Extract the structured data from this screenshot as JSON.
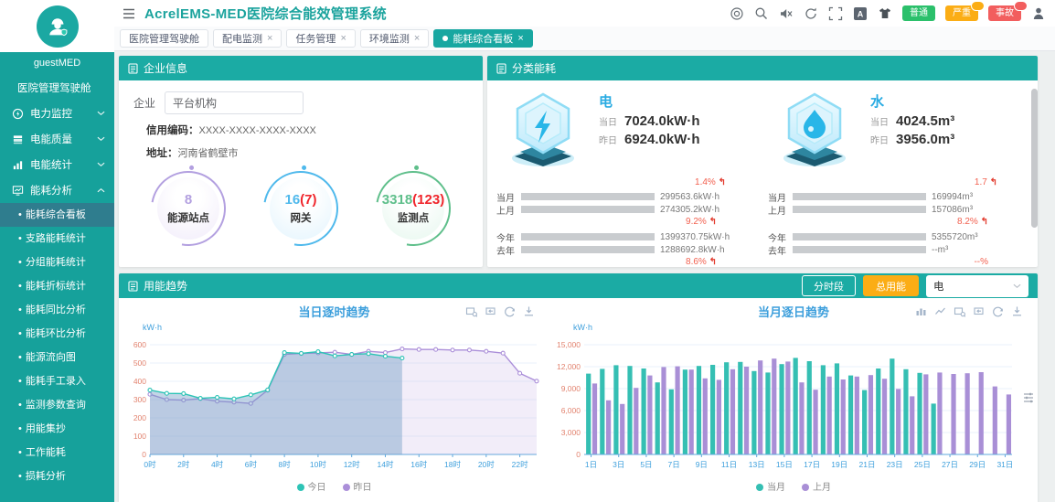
{
  "header": {
    "title": "AcrelEMS-MED医院综合能效管理系统",
    "alarm_badges": [
      {
        "label": "普通",
        "color": "#2BC06B",
        "bubble": false
      },
      {
        "label": "严重",
        "color": "#FBAD15",
        "bubble": true
      },
      {
        "label": "事故",
        "color": "#F25E5E",
        "bubble": true
      }
    ]
  },
  "tabs": [
    {
      "label": "医院管理驾驶舱",
      "closable": false,
      "active": false
    },
    {
      "label": "配电监测",
      "closable": true,
      "active": false
    },
    {
      "label": "任务管理",
      "closable": true,
      "active": false
    },
    {
      "label": "环境监测",
      "closable": true,
      "active": false
    },
    {
      "label": "能耗综合看板",
      "closable": true,
      "active": true
    }
  ],
  "sidebar": {
    "username": "guestMED",
    "dashboard": "医院管理驾驶舱",
    "groups": [
      {
        "label": "电力监控",
        "icon": "power",
        "expanded": false
      },
      {
        "label": "电能质量",
        "icon": "quality",
        "expanded": false
      },
      {
        "label": "电能统计",
        "icon": "stats",
        "expanded": false
      },
      {
        "label": "能耗分析",
        "icon": "analysis",
        "expanded": true
      }
    ],
    "submenu": [
      {
        "label": "能耗综合看板",
        "active": true
      },
      {
        "label": "支路能耗统计",
        "active": false
      },
      {
        "label": "分组能耗统计",
        "active": false
      },
      {
        "label": "能耗折标统计",
        "active": false
      },
      {
        "label": "能耗同比分析",
        "active": false
      },
      {
        "label": "能耗环比分析",
        "active": false
      },
      {
        "label": "能源流向图",
        "active": false
      },
      {
        "label": "能耗手工录入",
        "active": false
      },
      {
        "label": "监测参数查询",
        "active": false
      },
      {
        "label": "用能集抄",
        "active": false
      },
      {
        "label": "工作能耗",
        "active": false
      },
      {
        "label": "损耗分析",
        "active": false
      }
    ]
  },
  "enterprise": {
    "title": "企业信息",
    "company_label": "企业",
    "company_value": "平台机构",
    "credit_label": "信用编码：",
    "credit_value": "XXXX-XXXX-XXXX-XXXX",
    "address_label": "地址：",
    "address_value": "河南省鹤壁市",
    "stats": [
      {
        "value": "8",
        "extra": "",
        "label": "能源站点",
        "color": "#B3A0E0",
        "bg": "#F1ECFA"
      },
      {
        "value": "16",
        "extra": "(7)",
        "label": "网关",
        "color": "#4FB9EC",
        "bg": "#E3F4FD"
      },
      {
        "value": "3318",
        "extra": "(123)",
        "label": "监测点",
        "color": "#5FBF8B",
        "bg": "#E6F7EE"
      }
    ]
  },
  "energy": {
    "title": "分类能耗",
    "sections": [
      {
        "name": "电",
        "icon": "bolt",
        "bar_color": "#4CB8F0",
        "today_label": "当日",
        "today_value": "7024.0kW·h",
        "yest_label": "昨日",
        "yest_value": "6924.0kW·h",
        "day_change": "1.4%",
        "day_arrow": true,
        "bars1": [
          {
            "label": "当月",
            "value": "299563.6kW·h",
            "pct": 52
          },
          {
            "label": "上月",
            "value": "274305.2kW·h",
            "pct": 48
          }
        ],
        "change1": "9.2%",
        "arrow1": true,
        "bars2": [
          {
            "label": "今年",
            "value": "1399370.75kW·h",
            "pct": 53
          },
          {
            "label": "去年",
            "value": "1288692.8kW·h",
            "pct": 48
          }
        ],
        "change2": "8.6%",
        "arrow2": true
      },
      {
        "name": "水",
        "icon": "drop",
        "bar_color": "#4FBE87",
        "today_label": "当日",
        "today_value": "4024.5m³",
        "yest_label": "昨日",
        "yest_value": "3956.0m³",
        "day_change": "1.7",
        "day_arrow": true,
        "bars1": [
          {
            "label": "当月",
            "value": "169994m³",
            "pct": 47
          },
          {
            "label": "上月",
            "value": "157086m³",
            "pct": 43
          }
        ],
        "change1": "8.2%",
        "arrow1": true,
        "bars2": [
          {
            "label": "今年",
            "value": "5355720m³",
            "pct": 100
          },
          {
            "label": "去年",
            "value": "--m³",
            "pct": 0
          }
        ],
        "change2": "--%",
        "arrow2": false
      }
    ]
  },
  "trend": {
    "title": "用能趋势",
    "split_btn": "分时段",
    "total_btn": "总用能",
    "select_value": "电"
  },
  "chart_data": [
    {
      "type": "line",
      "title": "当日逐时趋势",
      "unit": "kW·h",
      "categories": [
        "0时",
        "1时",
        "2时",
        "3时",
        "4时",
        "5时",
        "6时",
        "7时",
        "8时",
        "9时",
        "10时",
        "11时",
        "12时",
        "13时",
        "14时",
        "15时",
        "16时",
        "17时",
        "18时",
        "19时",
        "20时",
        "21时",
        "22时",
        "23时"
      ],
      "ylim": [
        0,
        600
      ],
      "ytick": 100,
      "grid": true,
      "legend_position": "bottom",
      "series": [
        {
          "name": "昨日",
          "color": "#AB8FD9",
          "fill": "rgba(177,140,217,0.16)",
          "values": [
            329,
            300,
            297,
            305,
            291,
            286,
            279,
            351,
            547,
            552,
            555,
            559,
            547,
            564,
            557,
            577,
            574,
            574,
            571,
            571,
            564,
            554,
            444,
            401
          ]
        },
        {
          "name": "今日",
          "color": "#2EC4B6",
          "fill": "rgba(110,155,196,0.42)",
          "values": [
            352,
            334,
            333,
            307,
            312,
            304,
            326,
            353,
            557,
            553,
            562,
            539,
            547,
            551,
            537,
            527
          ]
        }
      ]
    },
    {
      "type": "bar",
      "title": "当月逐日趋势",
      "unit": "kW·h",
      "categories": [
        "1日",
        "2日",
        "3日",
        "4日",
        "5日",
        "6日",
        "7日",
        "8日",
        "9日",
        "10日",
        "11日",
        "12日",
        "13日",
        "14日",
        "15日",
        "16日",
        "17日",
        "18日",
        "19日",
        "20日",
        "21日",
        "22日",
        "23日",
        "24日",
        "25日",
        "26日",
        "27日",
        "28日",
        "29日",
        "30日",
        "31日"
      ],
      "ylim": [
        0,
        15000
      ],
      "ytick": 3000,
      "grid": true,
      "legend_position": "bottom",
      "series": [
        {
          "name": "当月",
          "color": "#35BFB3",
          "values": [
            11050,
            11700,
            12200,
            12100,
            11750,
            9850,
            8900,
            11600,
            12100,
            12250,
            12600,
            12650,
            11400,
            11200,
            12350,
            13200,
            12750,
            12200,
            12450,
            10800,
            8800,
            11750,
            13100,
            11650,
            11150,
            6950
          ]
        },
        {
          "name": "上月",
          "color": "#A98FD6",
          "values": [
            9700,
            7400,
            6900,
            9100,
            10800,
            11950,
            12050,
            11600,
            10400,
            10200,
            11650,
            12000,
            12850,
            13100,
            12700,
            9850,
            8850,
            10650,
            10250,
            10650,
            10850,
            10350,
            8950,
            7950,
            10950,
            11200,
            11000,
            11100,
            11250,
            9300,
            8200
          ]
        }
      ]
    }
  ]
}
